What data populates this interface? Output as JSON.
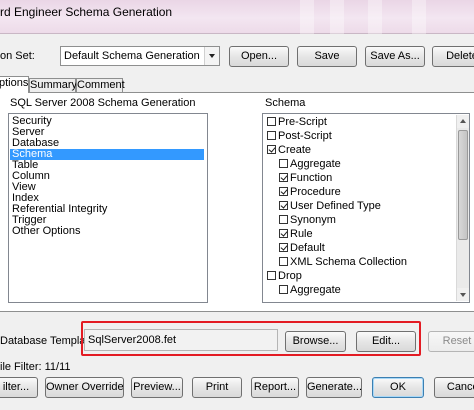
{
  "window": {
    "title": "rd Engineer Schema Generation"
  },
  "toolbar": {
    "option_set_label": "on Set:",
    "option_set_value": "Default Schema Generation",
    "open_label": "Open...",
    "save_label": "Save",
    "save_as_label": "Save As...",
    "delete_label": "Delete"
  },
  "tabs": [
    {
      "label": "ptions",
      "active": true
    },
    {
      "label": "Summary",
      "active": false
    },
    {
      "label": "Comment",
      "active": false
    }
  ],
  "left_panel": {
    "heading": "SQL Server 2008 Schema Generation",
    "items": [
      "Security",
      "Server",
      "Database",
      "Schema",
      "Table",
      "Column",
      "View",
      "Index",
      "Referential Integrity",
      "Trigger",
      "Other Options"
    ],
    "selected": "Schema"
  },
  "right_panel": {
    "heading": "Schema",
    "items": [
      {
        "label": "Pre-Script",
        "checked": false
      },
      {
        "label": "Post-Script",
        "checked": false
      },
      {
        "label": "Create",
        "checked": true
      },
      {
        "label": "Aggregate",
        "checked": false
      },
      {
        "label": "Function",
        "checked": true
      },
      {
        "label": "Procedure",
        "checked": true
      },
      {
        "label": "User Defined Type",
        "checked": true
      },
      {
        "label": "Synonym",
        "checked": false
      },
      {
        "label": "Rule",
        "checked": true
      },
      {
        "label": "Default",
        "checked": true
      },
      {
        "label": "XML Schema Collection",
        "checked": false
      },
      {
        "label": "Drop",
        "checked": false
      },
      {
        "label": "Aggregate",
        "checked": false
      }
    ]
  },
  "template": {
    "label": "Database Template:",
    "value": "SqlServer2008.fet",
    "browse_label": "Browse...",
    "edit_label": "Edit...",
    "reset_label": "Reset"
  },
  "file_filter": {
    "label": "ile Filter: 11/11"
  },
  "footer": {
    "filter_label": "ilter...",
    "owner_override_label": "Owner Override...",
    "preview_label": "Preview...",
    "print_label": "Print",
    "report_label": "Report...",
    "generate_label": "Generate...",
    "ok_label": "OK",
    "cancel_label": "Cancel"
  },
  "colors": {
    "selection": "#3399ff",
    "highlight_box": "#e31b23",
    "title_bar": "#ead6e6"
  }
}
